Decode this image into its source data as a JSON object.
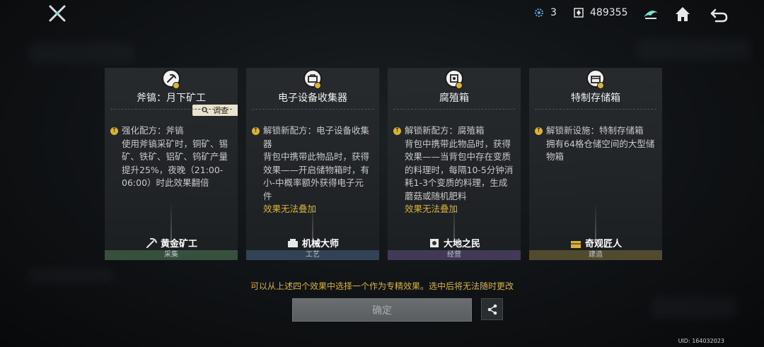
{
  "topbar": {
    "resource1_value": "3",
    "resource2_value": "489355",
    "icons": [
      "crossed-swords-logo-icon",
      "gear-resource-icon",
      "crystal-currency-icon",
      "emblem-icon",
      "home-icon",
      "back-icon"
    ]
  },
  "cards": [
    {
      "title": "斧镐：月下矿工",
      "inspect_label": "调查",
      "head": "强化配方：斧镐",
      "text": "使用斧镐采矿时，铜矿、锡矿、铁矿、铝矿、钨矿产量提升25%，夜晚（21:00-06:00）时此效果翻倍",
      "warn": "",
      "skill": "黄金矿工",
      "category": "采集",
      "category_color": "green"
    },
    {
      "title": "电子设备收集器",
      "head": "解锁新配方：电子设备收集器",
      "text": "背包中携带此物品时，获得效果——开启储物箱时，有小-中概率额外获得电子元件",
      "warn": "效果无法叠加",
      "skill": "机械大师",
      "category": "工艺",
      "category_color": "blue"
    },
    {
      "title": "腐殖箱",
      "head": "解锁新配方：腐殖箱",
      "text": "背包中携带此物品时，获得效果——当背包中存在变质的料理时，每隔10-5分钟消耗1-3个变质的料理，生成蘑菇或随机肥料",
      "warn": "效果无法叠加",
      "skill": "大地之民",
      "category": "经营",
      "category_color": "purple"
    },
    {
      "title": "特制存储箱",
      "head": "解锁新设施：特制存储箱",
      "text": "拥有64格仓储空间的大型储物箱",
      "warn": "",
      "skill": "奇观匠人",
      "category": "建造",
      "category_color": "gold"
    }
  ],
  "hint": "可以从上述四个效果中选择一个作为专精效果。选中后将无法随时更改",
  "confirm_label": "确定",
  "uid": "UID: 164032023",
  "colors": {
    "accent_gold": "#d8b23a",
    "bg": "#101315"
  }
}
